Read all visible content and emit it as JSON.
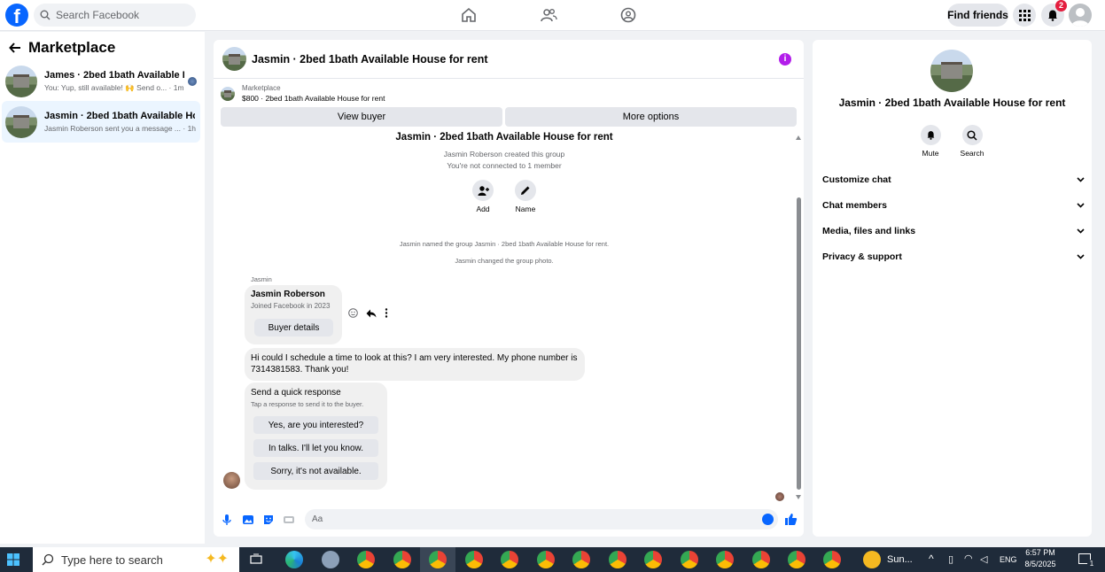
{
  "topbar": {
    "logo_letter": "f",
    "search_placeholder": "Search Facebook",
    "nav_icons": [
      "home-icon",
      "friends-icon",
      "groups-icon"
    ],
    "find_friends_label": "Find friends",
    "notification_count": "2",
    "colors": {
      "brand": "#0866ff",
      "badge": "#e41e3f"
    }
  },
  "sidebar": {
    "title": "Marketplace",
    "conversations": [
      {
        "title": "James · 2bed 1bath Available Ho...",
        "subtitle": "You: Yup, still available! 🙌 Send o... · 1m",
        "active": false
      },
      {
        "title": "Jasmin · 2bed 1bath Available Hou...",
        "subtitle": "Jasmin Roberson sent you a message ... · 1h",
        "active": true
      }
    ]
  },
  "chat": {
    "header_title": "Jasmin · 2bed 1bath Available House for rent",
    "info_icon_label": "i",
    "marketplace_label": "Marketplace",
    "listing": "$800 · 2bed 1bath Available House for rent",
    "view_buyer_label": "View buyer",
    "more_options_label": "More options",
    "group_title": "Jasmin · 2bed 1bath Available House for rent",
    "created_text": "Jasmin Roberson created this group",
    "connection_text": "You're not connected to 1 member",
    "add_label": "Add",
    "name_label": "Name",
    "system_messages": [
      "Jasmin named the group Jasmin · 2bed 1bath Available House for rent.",
      "Jasmin changed the group photo."
    ],
    "sender_name": "Jasmin",
    "profile_card": {
      "name": "Jasmin Roberson",
      "joined": "Joined Facebook in 2023",
      "button": "Buyer details"
    },
    "message": "Hi could I schedule a time to look at this? I am very interested. My phone number is 7314381583. Thank you!",
    "quick_response": {
      "title": "Send a quick response",
      "subtitle": "Tap a response to send it to the buyer.",
      "options": [
        "Yes, are you interested?",
        "In talks. I'll let you know.",
        "Sorry, it's not available."
      ]
    },
    "composer_placeholder": "Aa"
  },
  "details": {
    "title": "Jasmin · 2bed 1bath Available House for rent",
    "mute_label": "Mute",
    "search_label": "Search",
    "sections": [
      "Customize chat",
      "Chat members",
      "Media, files and links",
      "Privacy & support"
    ]
  },
  "taskbar": {
    "search_placeholder": "Type here to search",
    "weather": "Sun...",
    "language": "ENG",
    "time": "6:57 PM",
    "date": "8/5/2025",
    "notification_count": "1"
  }
}
